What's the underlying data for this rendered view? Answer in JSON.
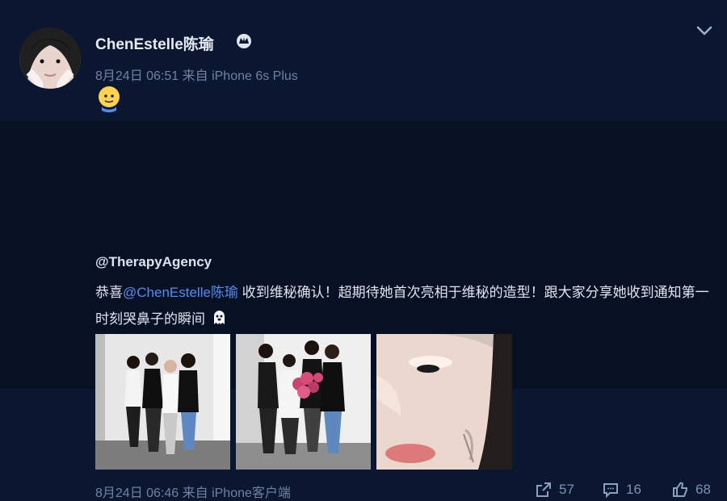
{
  "post": {
    "author_name": "ChenEstelle陈瑜",
    "meta": "8月24日 06:51 来自 iPhone 6s Plus",
    "emoji": "smile-face-icon"
  },
  "repost": {
    "mention": "@TherapyAgency",
    "content_prefix": "恭喜",
    "content_link": "@ChenEstelle陈瑜",
    "content_suffix": " 收到维秘确认！超期待她首次亮相于维秘的造型！跟大家分享她收到通知第一时刻哭鼻子的瞬间",
    "meta": "8月24日 06:46 来自 iPhone客户端",
    "share_count": "57",
    "comment_count": "16",
    "like_count": "68"
  },
  "colors": {
    "background": "#0b1730",
    "repost_background": "#081024",
    "link": "#4f8ff3",
    "meta": "#6f82a3"
  }
}
